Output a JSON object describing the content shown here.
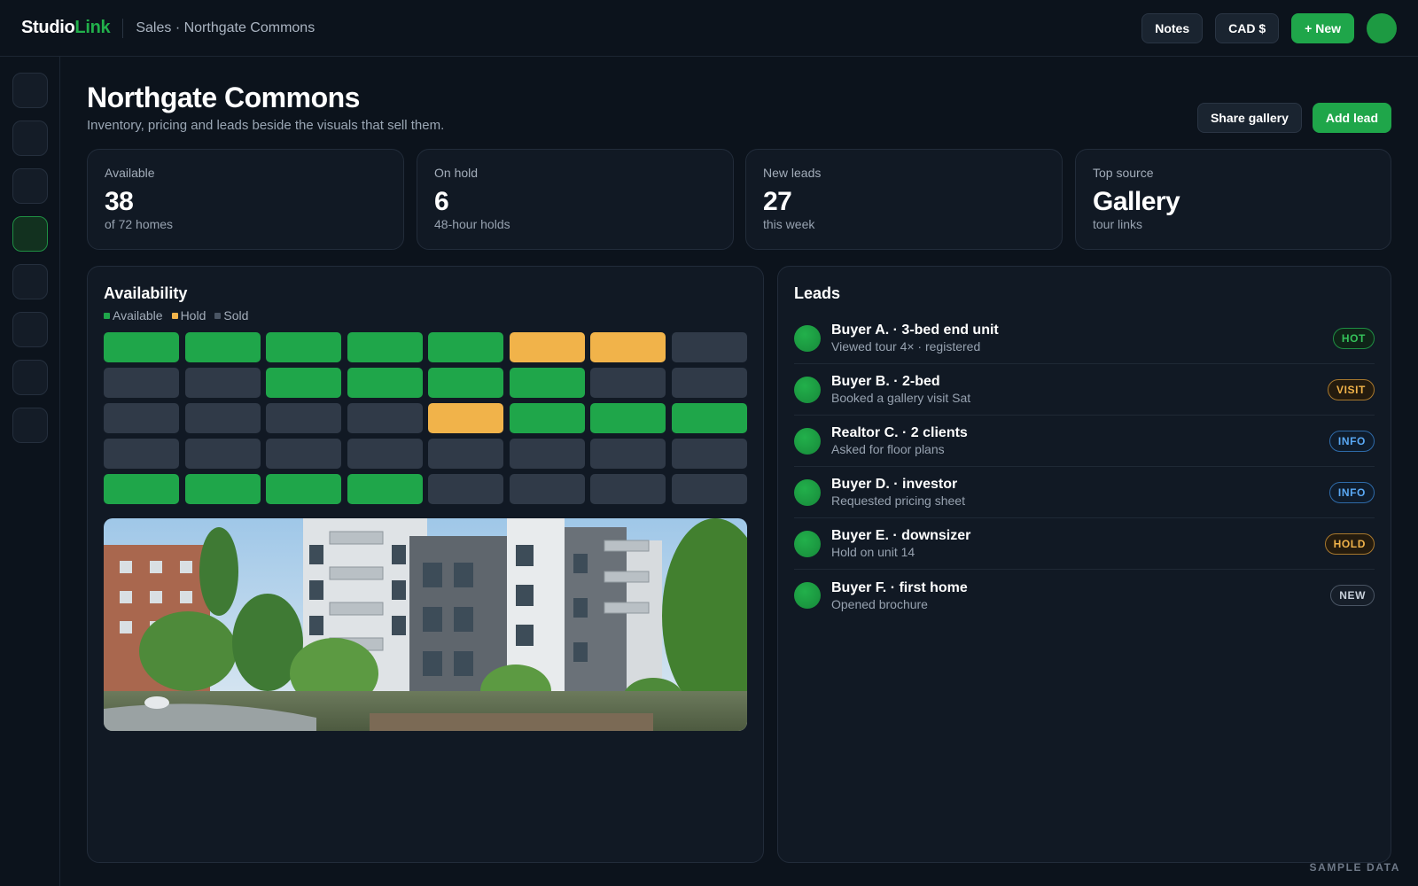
{
  "app": {
    "logo_main": "Studio",
    "logo_accent": "Link",
    "breadcrumb": "Sales · Northgate Commons"
  },
  "topbar": {
    "notes_label": "Notes",
    "currency_label": "CAD $",
    "new_label": "+ New"
  },
  "header": {
    "title": "Northgate Commons",
    "subtitle": "Inventory, pricing and leads beside the visuals that sell them.",
    "share_label": "Share gallery",
    "add_lead_label": "Add lead"
  },
  "stats": [
    {
      "label": "Available",
      "value": "38",
      "note": "of 72 homes"
    },
    {
      "label": "On hold",
      "value": "6",
      "note": "48-hour holds"
    },
    {
      "label": "New leads",
      "value": "27",
      "note": "this week"
    },
    {
      "label": "Top source",
      "value": "Gallery",
      "note": "tour links"
    }
  ],
  "availability": {
    "title": "Availability",
    "legend": {
      "available": "Available",
      "hold": "Hold",
      "sold": "Sold"
    },
    "colors": {
      "available": "#1fa64a",
      "hold": "#f1b34a",
      "sold": "#303a48"
    },
    "rows": [
      [
        "available",
        "available",
        "available",
        "available",
        "available",
        "hold",
        "hold",
        "sold"
      ],
      [
        "sold",
        "sold",
        "available",
        "available",
        "available",
        "available",
        "sold",
        "sold"
      ],
      [
        "sold",
        "sold",
        "sold",
        "sold",
        "hold",
        "available",
        "available",
        "available"
      ],
      [
        "sold",
        "sold",
        "sold",
        "sold",
        "sold",
        "sold",
        "sold",
        "sold"
      ],
      [
        "available",
        "available",
        "available",
        "available",
        "sold",
        "sold",
        "sold",
        "sold"
      ]
    ]
  },
  "leads": {
    "title": "Leads",
    "items": [
      {
        "name": "Buyer A. · 3-bed end unit",
        "detail": "Viewed tour 4× · registered",
        "badge": "HOT",
        "kind": "hot"
      },
      {
        "name": "Buyer B. · 2-bed",
        "detail": "Booked a gallery visit Sat",
        "badge": "VISIT",
        "kind": "visit"
      },
      {
        "name": "Realtor C. · 2 clients",
        "detail": "Asked for floor plans",
        "badge": "INFO",
        "kind": "info"
      },
      {
        "name": "Buyer D. · investor",
        "detail": "Requested pricing sheet",
        "badge": "INFO",
        "kind": "info"
      },
      {
        "name": "Buyer E. · downsizer",
        "detail": "Hold on unit 14",
        "badge": "HOLD",
        "kind": "hold"
      },
      {
        "name": "Buyer F. · first home",
        "detail": "Opened brochure",
        "badge": "NEW",
        "kind": "new"
      }
    ]
  },
  "footer": {
    "watermark": "SAMPLE DATA"
  }
}
